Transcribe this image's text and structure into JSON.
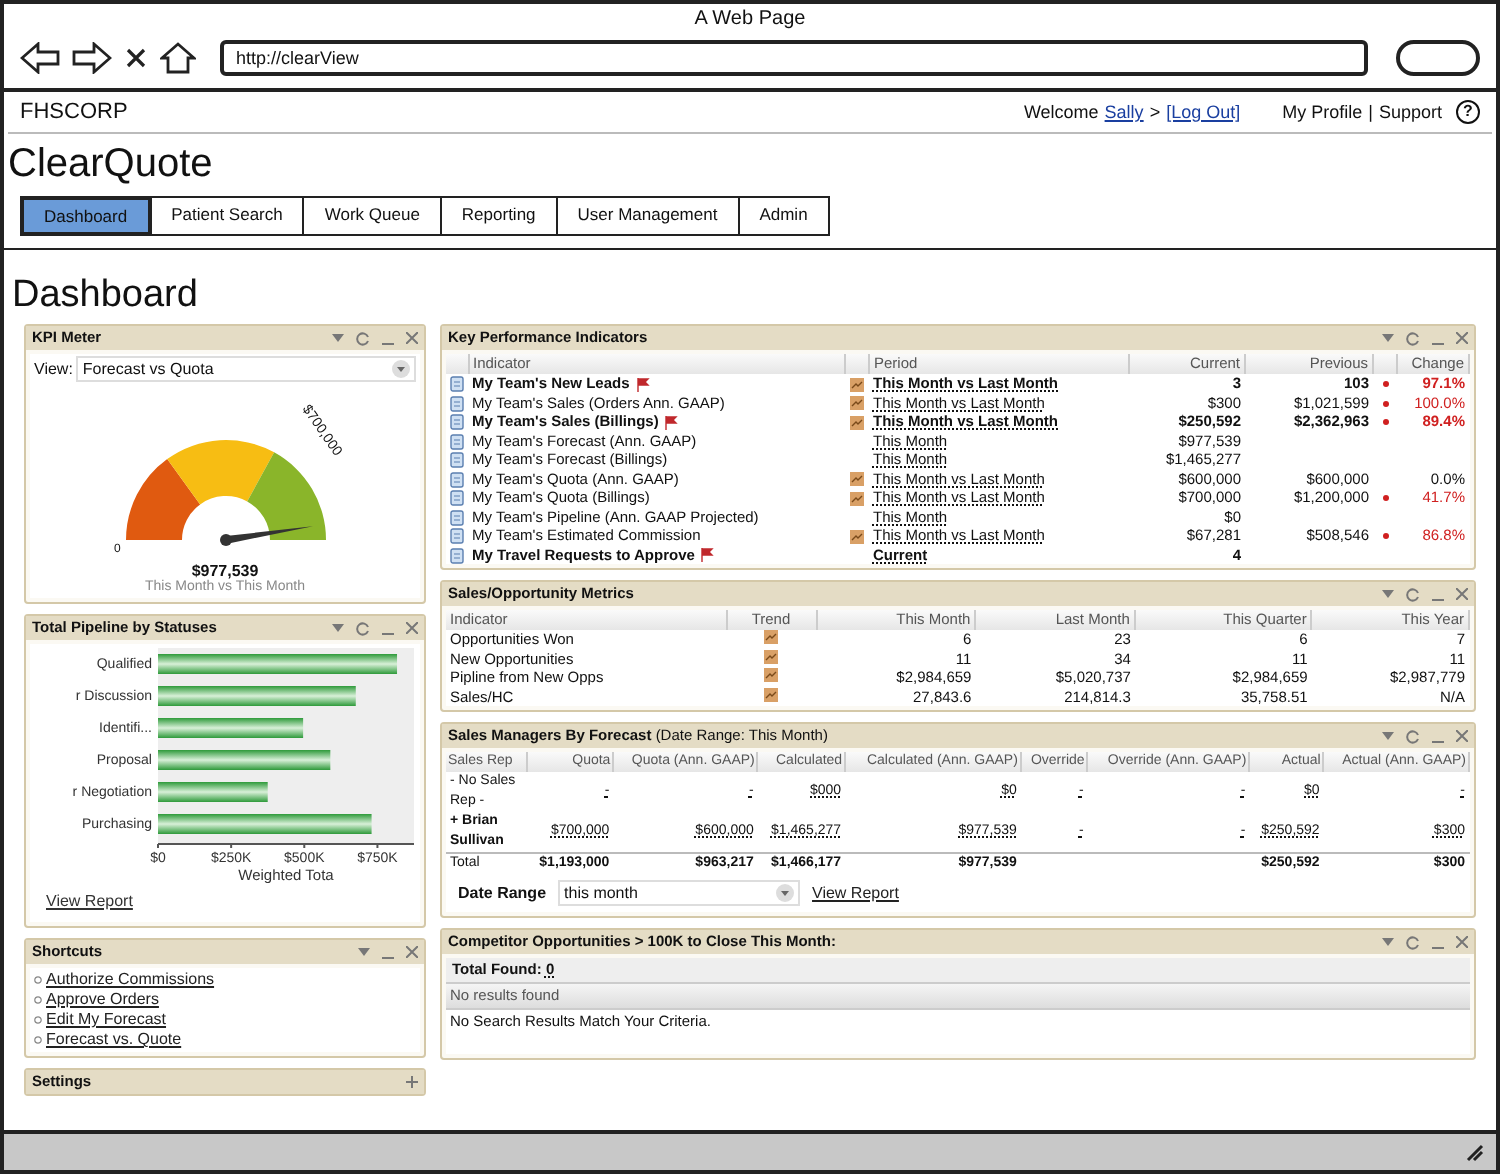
{
  "browser": {
    "title": "A Web Page",
    "url": "http://clearView"
  },
  "header": {
    "company": "FHSCORP",
    "welcome": "Welcome",
    "user": "Sally",
    "separator": ">",
    "logout": "[Log Out]",
    "profile": "My Profile",
    "divider": "|",
    "support": "Support",
    "help": "?"
  },
  "app_title": "ClearQuote",
  "tabs": [
    {
      "label": "Dashboard",
      "selected": true
    },
    {
      "label": "Patient Search",
      "selected": false
    },
    {
      "label": "Work Queue",
      "selected": false
    },
    {
      "label": "Reporting",
      "selected": false
    },
    {
      "label": "User Management",
      "selected": false
    },
    {
      "label": "Admin",
      "selected": false
    }
  ],
  "page_title": "Dashboard",
  "kpi_meter": {
    "title": "KPI Meter",
    "view_label": "View:",
    "view_value": "Forecast vs Quota",
    "min_label": "0",
    "max_label": "$700,000",
    "value": "$977,539",
    "caption": "This Month vs This Month"
  },
  "pipeline": {
    "title": "Total Pipeline by Statuses",
    "link": "View Report",
    "chart_data": {
      "type": "bar",
      "orientation": "horizontal",
      "xlabel": "Weighted Tota",
      "categories": [
        "Qualified",
        "r Discussion",
        "Identifi...",
        "Proposal",
        "r Negotiation",
        "Purchasing"
      ],
      "series": [
        {
          "color": "#2e9a3a",
          "values": [
            817000,
            676000,
            496000,
            589000,
            375000,
            730000
          ]
        }
      ],
      "xlim": [
        0,
        875000
      ],
      "xticks": [
        {
          "value": 0,
          "label": "$0"
        },
        {
          "value": 250000,
          "label": "$250K"
        },
        {
          "value": 500000,
          "label": "$500K"
        },
        {
          "value": 750000,
          "label": "$750K"
        }
      ]
    }
  },
  "shortcuts": {
    "title": "Shortcuts",
    "items": [
      "Authorize Commissions",
      "Approve Orders",
      "Edit My Forecast",
      "Forecast vs. Quote"
    ]
  },
  "settings": {
    "title": "Settings"
  },
  "kpi": {
    "title": "Key Performance Indicators",
    "columns": [
      "Indicator",
      "Period",
      "Current",
      "Previous",
      "Change"
    ],
    "rows": [
      {
        "name": "My Team's New Leads",
        "bold": true,
        "flagged": true,
        "trend": true,
        "period": "This Month vs Last Month",
        "current": "3",
        "previous": "103",
        "change": "97.1%",
        "negative": true
      },
      {
        "name": "My Team's Sales (Orders Ann. GAAP)",
        "bold": false,
        "flagged": false,
        "trend": true,
        "period": "This Month vs Last Month",
        "current": "$300",
        "previous": "$1,021,599",
        "change": "100.0%",
        "negative": true
      },
      {
        "name": "My Team's Sales (Billings)",
        "bold": true,
        "flagged": true,
        "trend": true,
        "period": "This Month vs Last Month",
        "current": "$250,592",
        "previous": "$2,362,963",
        "change": "89.4%",
        "negative": true
      },
      {
        "name": "My Team's Forecast (Ann. GAAP)",
        "bold": false,
        "flagged": false,
        "trend": false,
        "period": "This Month",
        "current": "$977,539",
        "negative": false
      },
      {
        "name": "My Team's Forecast (Billings)",
        "bold": false,
        "flagged": false,
        "trend": false,
        "period": "This Month",
        "current": "$1,465,277",
        "negative": false
      },
      {
        "name": "My Team's Quota (Ann. GAAP)",
        "bold": false,
        "flagged": false,
        "trend": true,
        "period": "This Month vs Last Month",
        "current": "$600,000",
        "previous": "$600,000",
        "change": "0.0%",
        "negative": false
      },
      {
        "name": "My Team's Quota (Billings)",
        "bold": false,
        "flagged": false,
        "trend": true,
        "period": "This Month vs Last Month",
        "current": "$700,000",
        "previous": "$1,200,000",
        "change": "41.7%",
        "negative": true
      },
      {
        "name": "My Team's Pipeline (Ann. GAAP Projected)",
        "bold": false,
        "flagged": false,
        "trend": false,
        "period": "This Month",
        "current": "$0",
        "negative": false
      },
      {
        "name": "My Team's Estimated Commission",
        "bold": false,
        "flagged": false,
        "trend": true,
        "period": "This Month vs Last Month",
        "current": "$67,281",
        "previous": "$508,546",
        "change": "86.8%",
        "negative": true
      },
      {
        "name": "My Travel Requests to Approve",
        "bold": true,
        "flagged": true,
        "trend": false,
        "period": "Current",
        "current": "4",
        "negative": false
      }
    ]
  },
  "metrics": {
    "title": "Sales/Opportunity Metrics",
    "columns": [
      "Indicator",
      "Trend",
      "This Month",
      "Last Month",
      "This Quarter",
      "This Year"
    ],
    "rows": [
      {
        "name": "Opportunities Won",
        "values": [
          "6",
          "23",
          "6",
          "7"
        ]
      },
      {
        "name": "New Opportunities",
        "values": [
          "11",
          "34",
          "11",
          "11"
        ]
      },
      {
        "name": "Pipline from New Opps",
        "values": [
          "$2,984,659",
          "$5,020,737",
          "$2,984,659",
          "$2,987,779"
        ]
      },
      {
        "name": "Sales/HC",
        "values": [
          "27,843.6",
          "214,814.3",
          "35,758.51",
          "N/A"
        ]
      }
    ]
  },
  "managers": {
    "title": "Sales Managers By Forecast",
    "subtitle": "(Date Range: This Month)",
    "columns": [
      "Sales Rep",
      "Quota",
      "Quota (Ann. GAAP)",
      "Calculated",
      "Calculated (Ann. GAAP)",
      "Override",
      "Override (Ann. GAAP)",
      "Actual",
      "Actual (Ann. GAAP)"
    ],
    "rows": [
      {
        "rep": "- No Sales Rep -",
        "bold": false,
        "values": [
          "-",
          "-",
          "$000",
          "$0",
          "-",
          "-",
          "$0",
          "-"
        ]
      },
      {
        "rep": "+ Brian Sullivan",
        "bold": true,
        "values": [
          "$700,000",
          "$600,000",
          "$1,465,277",
          "$977,539",
          "-",
          "-",
          "$250,592",
          "$300"
        ]
      }
    ],
    "total": {
      "label": "Total",
      "values": [
        "$1,193,000",
        "$963,217",
        "$1,466,177",
        "$977,539"
      ],
      "actual_values": [
        "$250,592",
        "$300"
      ]
    },
    "date_range_label": "Date Range",
    "date_range_value": "this month",
    "link": "View Report"
  },
  "competitors": {
    "title": "Competitor Opportunities > 100K to Close This Month:",
    "total_label": "Total Found:",
    "total": "0",
    "status": "No results found",
    "message": "No Search Results Match Your Criteria."
  }
}
